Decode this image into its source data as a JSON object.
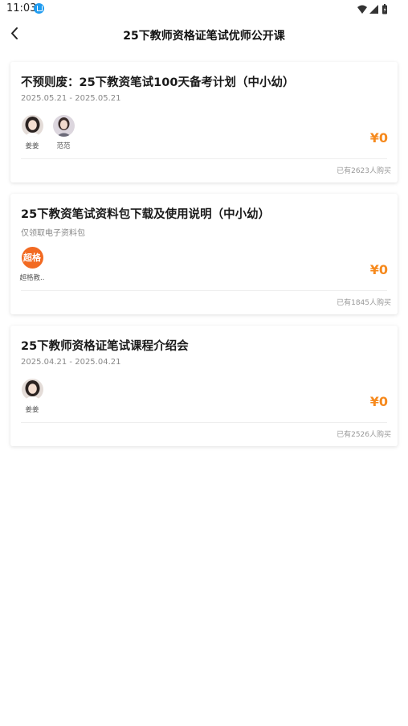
{
  "status_bar": {
    "time": "11:03"
  },
  "nav": {
    "title": "25下教师资格证笔试优师公开课"
  },
  "courses": [
    {
      "title": "不预则废：25下教资笔试100天备考计划（中小幼）",
      "subtitle": "2025.05.21 - 2025.05.21",
      "teachers": [
        {
          "name": "姜姜"
        },
        {
          "name": "范范"
        }
      ],
      "price": "¥0",
      "buyers": "已有2623人购买"
    },
    {
      "title": "25下教资笔试资料包下载及使用说明（中小幼）",
      "subtitle": "仅领取电子资料包",
      "teachers": [
        {
          "name": "超格教..",
          "logo_text": "超格"
        }
      ],
      "price": "¥0",
      "buyers": "已有1845人购买"
    },
    {
      "title": "25下教师资格证笔试课程介绍会",
      "subtitle": "2025.04.21 - 2025.04.21",
      "teachers": [
        {
          "name": "姜姜"
        }
      ],
      "price": "¥0",
      "buyers": "已有2526人购买"
    }
  ],
  "colors": {
    "price": "#f68a1e",
    "logo": "#f26a22",
    "status_icon": "#1e9bf0"
  }
}
